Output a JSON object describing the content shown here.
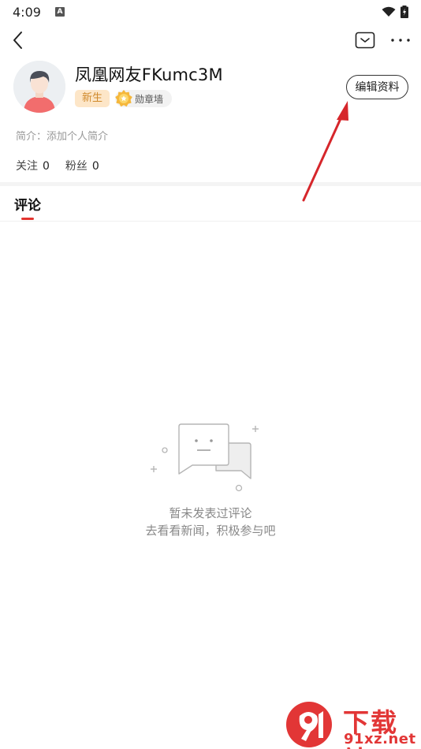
{
  "status_bar": {
    "time": "4:09",
    "notification_icon": "a-letter-icon",
    "wifi_icon": "wifi-icon",
    "battery_icon": "battery-charging-icon"
  },
  "nav": {
    "back_icon": "chevron-left-icon",
    "message_icon": "message-box-icon",
    "more_icon": "more-dots-icon"
  },
  "profile": {
    "username": "凤凰网友FKumc3M",
    "level_badge": "新生",
    "medal_wall": "勋章墙",
    "edit_button": "编辑资料",
    "bio": "简介：添加个人简介",
    "following_label": "关注",
    "following_count": "0",
    "followers_label": "粉丝",
    "followers_count": "0"
  },
  "tabs": [
    {
      "label": "评论",
      "active": true
    }
  ],
  "empty_state": {
    "title": "暂未发表过评论",
    "subtitle": "去看看新闻，积极参与吧"
  },
  "watermark": {
    "brand_top": "下载站",
    "brand_bottom": "91xz.net"
  },
  "colors": {
    "accent_red": "#e3342f",
    "badge_bg": "#fde6c8",
    "badge_text": "#d08a2c",
    "muted_text": "#999999"
  }
}
